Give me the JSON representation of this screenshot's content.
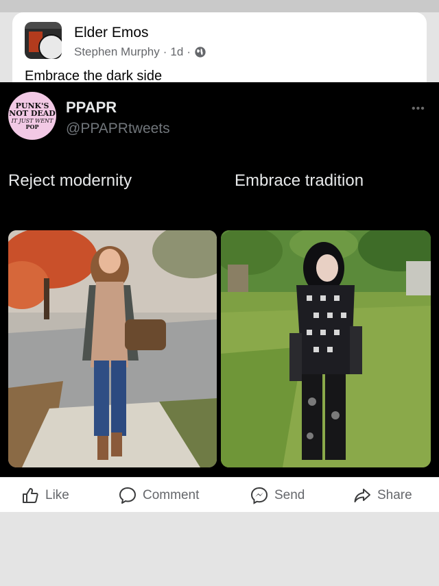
{
  "post": {
    "group_name": "Elder Emos",
    "author": "Stephen Murphy",
    "sep1": "·",
    "time": "1d",
    "sep2": "·",
    "caption": "Embrace the dark side"
  },
  "tweet": {
    "name": "PPAPR",
    "handle": "@PPAPRtweets",
    "more": "•••",
    "avatar_lines": [
      "PUNK'S",
      "NOT DEAD",
      "IT JUST WENT",
      "POP"
    ],
    "left_text": "Reject modernity",
    "right_text": "Embrace tradition"
  },
  "actions": {
    "like": "Like",
    "comment": "Comment",
    "send": "Send",
    "share": "Share"
  },
  "icons": {
    "globe": "globe-icon",
    "like": "thumbs-up-icon",
    "comment": "comment-bubble-icon",
    "send": "messenger-icon",
    "share": "share-arrow-icon"
  },
  "colors": {
    "text_secondary": "#65676b",
    "tweet_bg": "#000000",
    "tweet_text": "#e7e9ea",
    "handle_gray": "#71767b"
  }
}
